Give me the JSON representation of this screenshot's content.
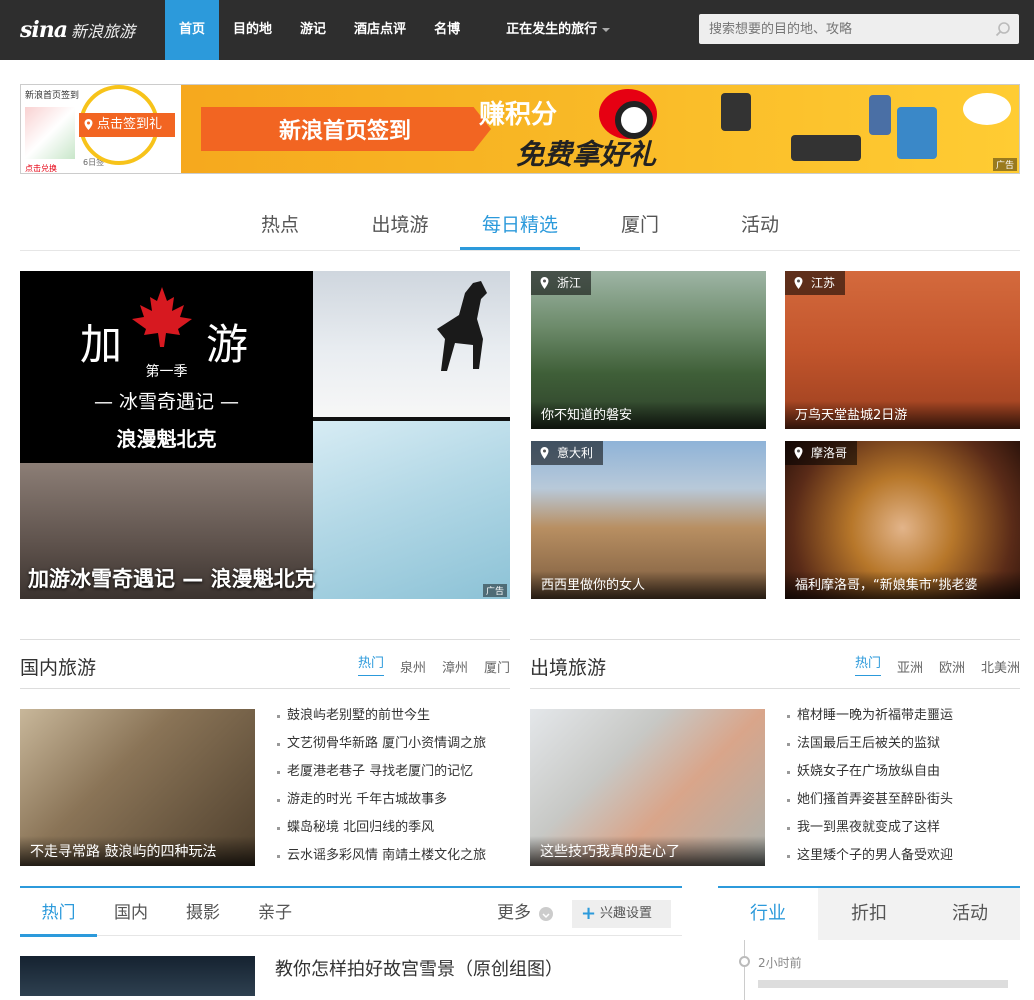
{
  "header": {
    "logo_mark": "sina",
    "logo_text": "新浪旅游",
    "nav": [
      "首页",
      "目的地",
      "游记",
      "酒店点评",
      "名博"
    ],
    "nav_dropdown": "正在发生的旅行",
    "search_placeholder": "搜索想要的目的地、攻略",
    "accent_color": "#2c9adb"
  },
  "banner": {
    "left_top": "新浪首页签到",
    "checkin_label": "点击签到",
    "checkin_extra": "礼",
    "left_bottom": "点击兑换",
    "left_bottom2": "6日签",
    "headline": "新浪首页签到",
    "earn": "赚积分",
    "free_gift": "免费拿好礼",
    "ad_tag": "广告"
  },
  "tabs": [
    "热点",
    "出境游",
    "每日精选",
    "厦门",
    "活动"
  ],
  "active_tab": "每日精选",
  "featured_ad": {
    "jia": "加",
    "you": "游",
    "season": "第一季",
    "subtitle": "— 冰雪奇遇记 —",
    "city": "浪漫魁北克",
    "caption": "加游冰雪奇遇记 — 浪漫魁北克",
    "ad_tag": "广告"
  },
  "photos": [
    {
      "location": "浙江",
      "caption": "你不知道的磐安"
    },
    {
      "location": "江苏",
      "caption": "万鸟天堂盐城2日游"
    },
    {
      "location": "意大利",
      "caption": "西西里做你的女人"
    },
    {
      "location": "摩洛哥",
      "caption": "福利摩洛哥，“新娘集市”挑老婆"
    }
  ],
  "domestic": {
    "title": "国内旅游",
    "tags": [
      "热门",
      "泉州",
      "漳州",
      "厦门"
    ],
    "thumb_caption": "不走寻常路 鼓浪屿的四种玩法",
    "items": [
      "鼓浪屿老别墅的前世今生",
      "文艺彻骨华新路 厦门小资情调之旅",
      "老厦港老巷子 寻找老厦门的记忆",
      "游走的时光 千年古城故事多",
      "蝶岛秘境 北回归线的季风",
      "云水谣多彩风情 南靖土楼文化之旅"
    ]
  },
  "outbound": {
    "title": "出境旅游",
    "tags": [
      "热门",
      "亚洲",
      "欧洲",
      "北美洲"
    ],
    "thumb_caption": "这些技巧我真的走心了",
    "items": [
      "棺材睡一晚为祈福带走噩运",
      "法国最后王后被关的监狱",
      "妖娆女子在广场放纵自由",
      "她们搔首弄姿甚至醉卧街头",
      "我一到黑夜就变成了这样",
      "这里矮个子的男人备受欢迎"
    ]
  },
  "bottom_tabs": {
    "tabs": [
      "热门",
      "国内",
      "摄影",
      "亲子"
    ],
    "more": "更多",
    "pref": "兴趣设置"
  },
  "article": {
    "title": "教你怎样拍好故宫雪景（原创组图）"
  },
  "sidebar": {
    "tabs": [
      "行业",
      "折扣",
      "活动"
    ],
    "time": "2小时前"
  }
}
